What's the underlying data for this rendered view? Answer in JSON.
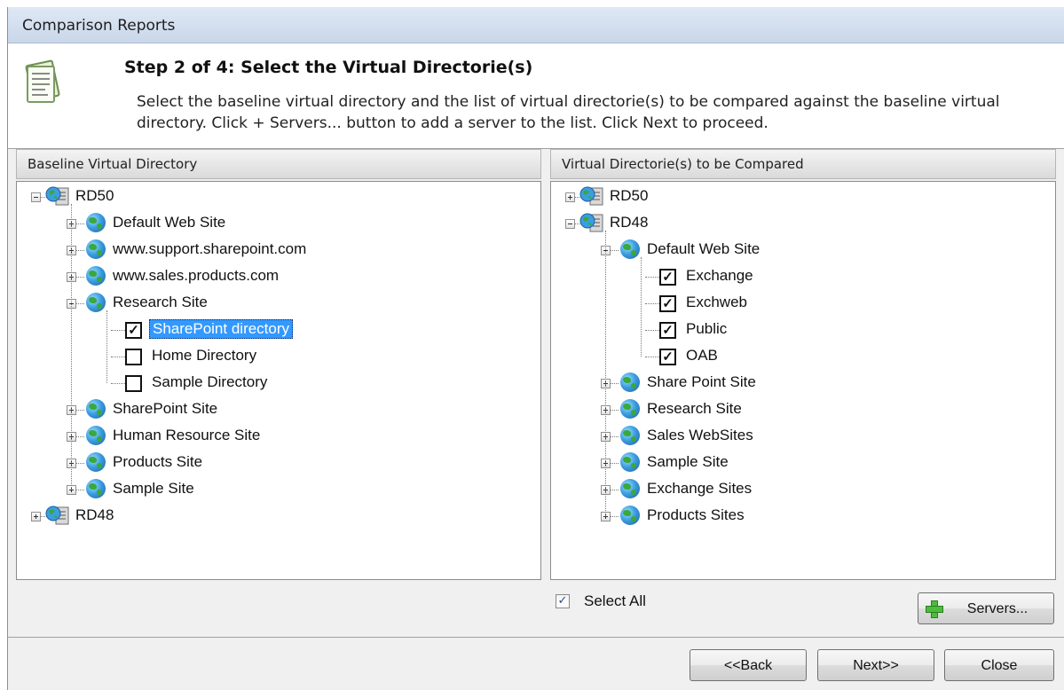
{
  "window": {
    "title": "Comparison Reports"
  },
  "header": {
    "step_title": "Step 2  of 4: Select the Virtual Directorie(s)",
    "description": "Select the baseline virtual directory and the list of virtual directorie(s) to be compared against the baseline virtual directory. Click + Servers... button to add a server to the list. Click Next to proceed."
  },
  "baseline": {
    "header": "Baseline Virtual Directory",
    "nodes": [
      {
        "label": "RD50",
        "type": "server",
        "expander": "minus"
      },
      {
        "label": "Default Web Site",
        "type": "site",
        "expander": "plus"
      },
      {
        "label": "www.support.sharepoint.com",
        "type": "site",
        "expander": "plus"
      },
      {
        "label": "www.sales.products.com",
        "type": "site",
        "expander": "plus"
      },
      {
        "label": "Research Site",
        "type": "site",
        "expander": "minus"
      },
      {
        "label": "SharePoint directory",
        "type": "dir",
        "checked": true,
        "selected": true
      },
      {
        "label": "Home Directory",
        "type": "dir",
        "checked": false
      },
      {
        "label": "Sample Directory",
        "type": "dir",
        "checked": false
      },
      {
        "label": "SharePoint Site",
        "type": "site",
        "expander": "plus"
      },
      {
        "label": "Human Resource Site",
        "type": "site",
        "expander": "plus"
      },
      {
        "label": "Products Site",
        "type": "site",
        "expander": "plus"
      },
      {
        "label": "Sample Site",
        "type": "site",
        "expander": "plus"
      },
      {
        "label": "RD48",
        "type": "server",
        "expander": "plus"
      }
    ]
  },
  "compare": {
    "header": "Virtual Directorie(s) to be Compared",
    "nodes": [
      {
        "label": "RD50",
        "type": "server",
        "expander": "plus"
      },
      {
        "label": "RD48",
        "type": "server",
        "expander": "minus"
      },
      {
        "label": "Default Web Site",
        "type": "site",
        "expander": "minus"
      },
      {
        "label": "Exchange",
        "type": "dir",
        "checked": true
      },
      {
        "label": "Exchweb",
        "type": "dir",
        "checked": true
      },
      {
        "label": "Public",
        "type": "dir",
        "checked": true
      },
      {
        "label": "OAB",
        "type": "dir",
        "checked": true
      },
      {
        "label": "Share Point Site",
        "type": "site",
        "expander": "plus"
      },
      {
        "label": "Research Site",
        "type": "site",
        "expander": "plus"
      },
      {
        "label": "Sales WebSites",
        "type": "site",
        "expander": "plus"
      },
      {
        "label": "Sample Site",
        "type": "site",
        "expander": "plus"
      },
      {
        "label": "Exchange Sites",
        "type": "site",
        "expander": "plus"
      },
      {
        "label": "Products Sites",
        "type": "site",
        "expander": "plus"
      }
    ]
  },
  "select_all": {
    "label": "Select All",
    "checked": true
  },
  "buttons": {
    "servers": "Servers...",
    "back": "<<Back",
    "next": "Next>>",
    "close": "Close"
  },
  "colors": {
    "selection": "#3399ff",
    "title_bar": "#c9d7ea"
  }
}
